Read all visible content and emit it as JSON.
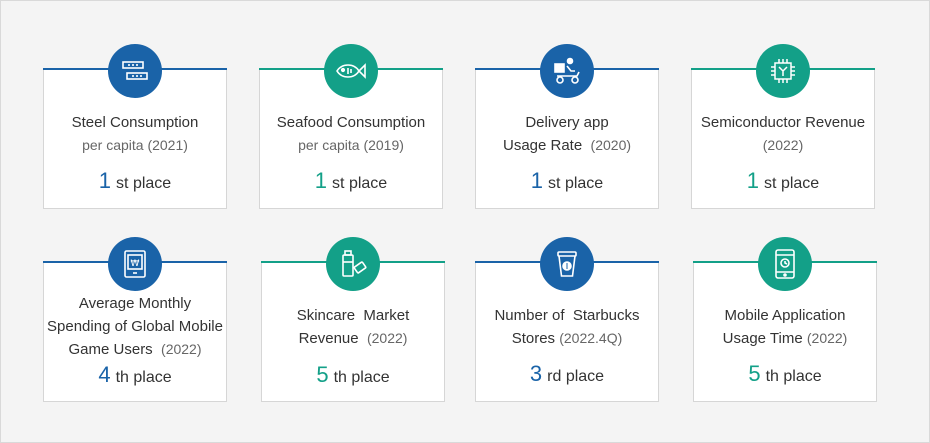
{
  "cards": [
    {
      "title": "Steel Consumption",
      "subtitle": "per capita (2021)",
      "rank_number": "1",
      "rank_suffix": "st place",
      "icon": "steel-beam-icon",
      "color": "#1a63a8"
    },
    {
      "title": "Seafood Consumption",
      "subtitle": "per capita (2019)",
      "rank_number": "1",
      "rank_suffix": "st place",
      "icon": "fish-icon",
      "color": "#13a088"
    },
    {
      "title": "Delivery app",
      "title2": "Usage Rate",
      "subtitle": "(2020)",
      "rank_number": "1",
      "rank_suffix": "st place",
      "icon": "delivery-scooter-icon",
      "color": "#1a63a8"
    },
    {
      "title": "Semiconductor Revenue",
      "subtitle": "(2022)",
      "rank_number": "1",
      "rank_suffix": "st place",
      "icon": "microchip-icon",
      "color": "#13a088"
    },
    {
      "title": "Average Monthly",
      "title2": "Spending of Global Mobile",
      "title3": "Game Users",
      "subtitle": "(2022)",
      "rank_number": "4",
      "rank_suffix": "th place",
      "icon": "won-tablet-icon",
      "color": "#1a63a8"
    },
    {
      "title": "Skincare  Market",
      "title2": "Revenue",
      "subtitle": "(2022)",
      "rank_number": "5",
      "rank_suffix": "th place",
      "icon": "cosmetics-icon",
      "color": "#13a088"
    },
    {
      "title": "Number of  Starbucks",
      "title2": "Stores",
      "subtitle": "(2022.4Q)",
      "rank_number": "3",
      "rank_suffix": "rd place",
      "icon": "coffee-cup-icon",
      "color": "#1a63a8"
    },
    {
      "title": "Mobile Application",
      "title2": "Usage Time",
      "subtitle": "(2022)",
      "rank_number": "5",
      "rank_suffix": "th place",
      "icon": "mobile-phone-icon",
      "color": "#13a088"
    }
  ]
}
